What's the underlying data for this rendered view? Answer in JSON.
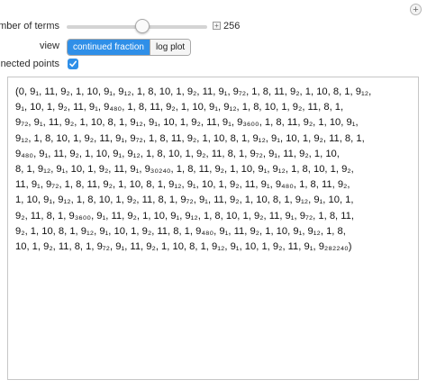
{
  "controls": {
    "plus_glyph": "+",
    "terms": {
      "label": "number of terms",
      "value": "256",
      "position_fraction": 0.54,
      "plus_glyph": "+"
    },
    "view": {
      "label": "view",
      "options": [
        "continued fraction",
        "log plot"
      ],
      "selected": "continued fraction"
    },
    "connected": {
      "label": "connected points",
      "checked": true
    }
  },
  "colors": {
    "accent": "#2f8fe8",
    "panel_border": "#c6c6c6"
  },
  "output": {
    "lines": [
      "(0, 9₁, 11, 9₂, 1, 10, 9₁, 9₁₂, 1, 8, 10, 1, 9₂, 11, 9₁, 9₇₂, 1, 8, 11, 9₂, 1, 10, 8, 1, 9₁₂,",
      "9₁, 10, 1, 9₂, 11, 9₁, 9₄₈₀, 1, 8, 11, 9₂, 1, 10, 9₁, 9₁₂, 1, 8, 10, 1, 9₂, 11, 8, 1,",
      "9₇₂, 9₁, 11, 9₂, 1, 10, 8, 1, 9₁₂, 9₁, 10, 1, 9₂, 11, 9₁, 9₃₆₀₀, 1, 8, 11, 9₂, 1, 10, 9₁,",
      "9₁₂, 1, 8, 10, 1, 9₂, 11, 9₁, 9₇₂, 1, 8, 11, 9₂, 1, 10, 8, 1, 9₁₂, 9₁, 10, 1, 9₂, 11, 8, 1,",
      "9₄₈₀, 9₁, 11, 9₂, 1, 10, 9₁, 9₁₂, 1, 8, 10, 1, 9₂, 11, 8, 1, 9₇₂, 9₁, 11, 9₂, 1, 10,",
      "8, 1, 9₁₂, 9₁, 10, 1, 9₂, 11, 9₁, 9₃₀₂₄₀, 1, 8, 11, 9₂, 1, 10, 9₁, 9₁₂, 1, 8, 10, 1, 9₂,",
      "11, 9₁, 9₇₂, 1, 8, 11, 9₂, 1, 10, 8, 1, 9₁₂, 9₁, 10, 1, 9₂, 11, 9₁, 9₄₈₀, 1, 8, 11, 9₂,",
      "1, 10, 9₁, 9₁₂, 1, 8, 10, 1, 9₂, 11, 8, 1, 9₇₂, 9₁, 11, 9₂, 1, 10, 8, 1, 9₁₂, 9₁, 10, 1,",
      "9₂, 11, 8, 1, 9₃₆₀₀, 9₁, 11, 9₂, 1, 10, 9₁, 9₁₂, 1, 8, 10, 1, 9₂, 11, 9₁, 9₇₂, 1, 8, 11,",
      "9₂, 1, 10, 8, 1, 9₁₂, 9₁, 10, 1, 9₂, 11, 8, 1, 9₄₈₀, 9₁, 11, 9₂, 1, 10, 9₁, 9₁₂, 1, 8,",
      "10, 1, 9₂, 11, 8, 1, 9₇₂, 9₁, 11, 9₂, 1, 10, 8, 1, 9₁₂, 9₁, 10, 1, 9₂, 11, 9₁, 9₂₈₂₂₄₀)"
    ]
  }
}
